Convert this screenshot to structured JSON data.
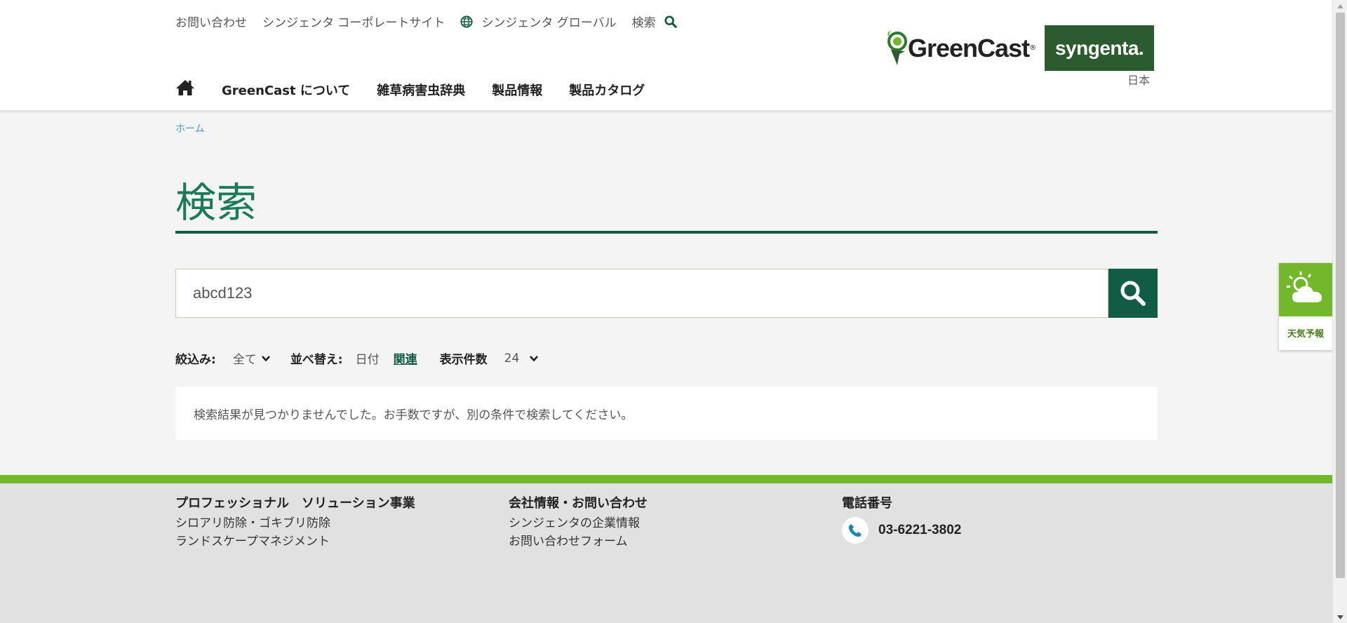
{
  "header": {
    "utility": {
      "contact": "お問い合わせ",
      "corporate": "シンジェンタ コーポレートサイト",
      "global": "シンジェンタ グローバル",
      "search": "検索"
    },
    "logo_text": "GreenCast",
    "logo_reg": "®",
    "brand": "syngenta.",
    "country": "日本",
    "nav": [
      "GreenCast について",
      "雑草病害虫辞典",
      "製品情報",
      "製品カタログ"
    ]
  },
  "breadcrumb": "ホーム",
  "page_title": "検索",
  "search": {
    "value": "abcd123"
  },
  "filters": {
    "filter_label": "絞込み:",
    "filter_value": "全て",
    "sort_label": "並べ替え:",
    "sort_date": "日付",
    "sort_relevance": "関連",
    "count_label": "表示件数",
    "count_value": "24"
  },
  "results_message": "検索結果が見つかりませんでした。お手数ですが、別の条件で検索してください。",
  "footer": {
    "col1": {
      "heading": "プロフェッショナル　ソリューション事業",
      "links": [
        "シロアリ防除・ゴキブリ防除",
        "ランドスケープマネジメント"
      ]
    },
    "col2": {
      "heading": "会社情報・お問い合わせ",
      "links": [
        "シンジェンタの企業情報",
        "お問い合わせフォーム"
      ]
    },
    "col3": {
      "heading": "電話番号",
      "phone": "03-6221-3802"
    }
  },
  "weather_widget": {
    "label": "天気予報"
  },
  "colors": {
    "brand_green": "#125c45",
    "accent_green": "#73b72b",
    "syngenta_green": "#2b5b2f"
  }
}
